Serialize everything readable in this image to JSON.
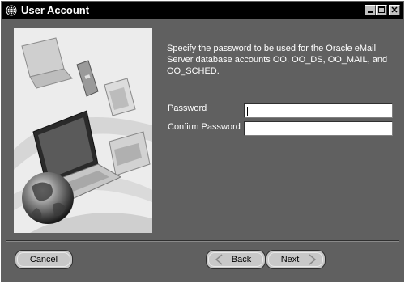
{
  "window": {
    "title": "User Account"
  },
  "description": "Specify the password to be used for the Oracle eMail Server database accounts OO, OO_DS, OO_MAIL, and OO_SCHED.",
  "form": {
    "password_label": "Password",
    "password_value": "",
    "confirm_label": "Confirm Password",
    "confirm_value": ""
  },
  "buttons": {
    "cancel": "Cancel",
    "back": "Back",
    "next": "Next"
  },
  "icons": {
    "app": "globe-icon",
    "minimize": "minimize-icon",
    "maximize": "maximize-icon",
    "close": "close-icon",
    "back": "chevron-left-icon",
    "next": "chevron-right-icon"
  }
}
